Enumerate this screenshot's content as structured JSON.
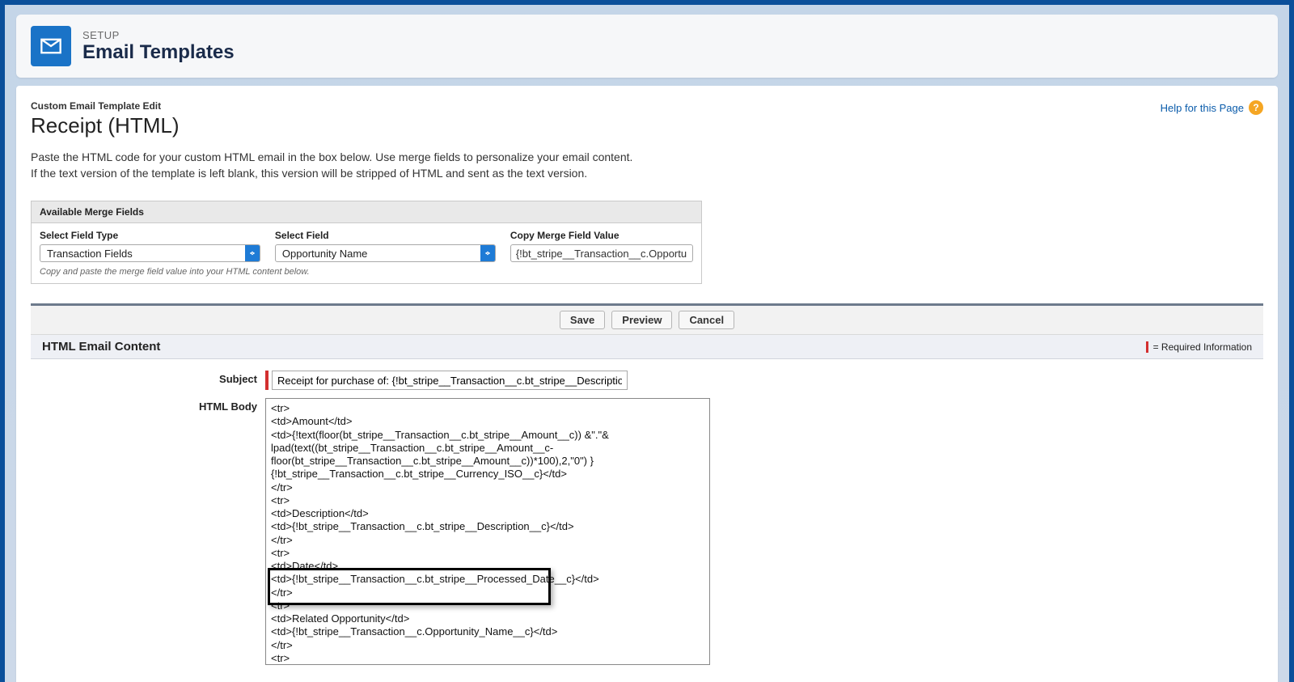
{
  "header": {
    "eyebrow": "SETUP",
    "title": "Email Templates"
  },
  "page": {
    "crumb": "Custom Email Template Edit",
    "title": "Receipt (HTML)",
    "help_link": "Help for this Page",
    "intro_line1": "Paste the HTML code for your custom HTML email in the box below. Use merge fields to personalize your email content.",
    "intro_line2": "If the text version of the template is left blank, this version will be stripped of HTML and sent as the text version."
  },
  "merge": {
    "box_title": "Available Merge Fields",
    "type_label": "Select Field Type",
    "type_value": "Transaction Fields",
    "field_label": "Select Field",
    "field_value": "Opportunity Name",
    "copy_label": "Copy Merge Field Value",
    "copy_value": "{!bt_stripe__Transaction__c.Opportunit",
    "note": "Copy and paste the merge field value into your HTML content below."
  },
  "buttons": {
    "save": "Save",
    "preview": "Preview",
    "cancel": "Cancel"
  },
  "section": {
    "title": "HTML Email Content",
    "required_text": "= Required Information"
  },
  "form": {
    "subject_label": "Subject",
    "subject_value": "Receipt for purchase of: {!bt_stripe__Transaction__c.bt_stripe__Description__",
    "body_label": "HTML Body",
    "body_value": "<tr>\n<td>Amount</td>\n<td>{!text(floor(bt_stripe__Transaction__c.bt_stripe__Amount__c)) &\".\"&\nlpad(text((bt_stripe__Transaction__c.bt_stripe__Amount__c-\nfloor(bt_stripe__Transaction__c.bt_stripe__Amount__c))*100),2,\"0\") }\n{!bt_stripe__Transaction__c.bt_stripe__Currency_ISO__c}</td>\n</tr>\n<tr>\n<td>Description</td>\n<td>{!bt_stripe__Transaction__c.bt_stripe__Description__c}</td>\n</tr>\n<tr>\n<td>Date</td>\n<td>{!bt_stripe__Transaction__c.bt_stripe__Processed_Date__c}</td>\n</tr>\n<tr>\n<td>Related Opportunity</td>\n<td>{!bt_stripe__Transaction__c.Opportunity_Name__c}</td>\n</tr>\n<tr>\n<td>ID</td>\n<td>{!bt_stripe__Transaction__c.Name}</td>\n</tr>\n</tbody>\n</table>"
  }
}
